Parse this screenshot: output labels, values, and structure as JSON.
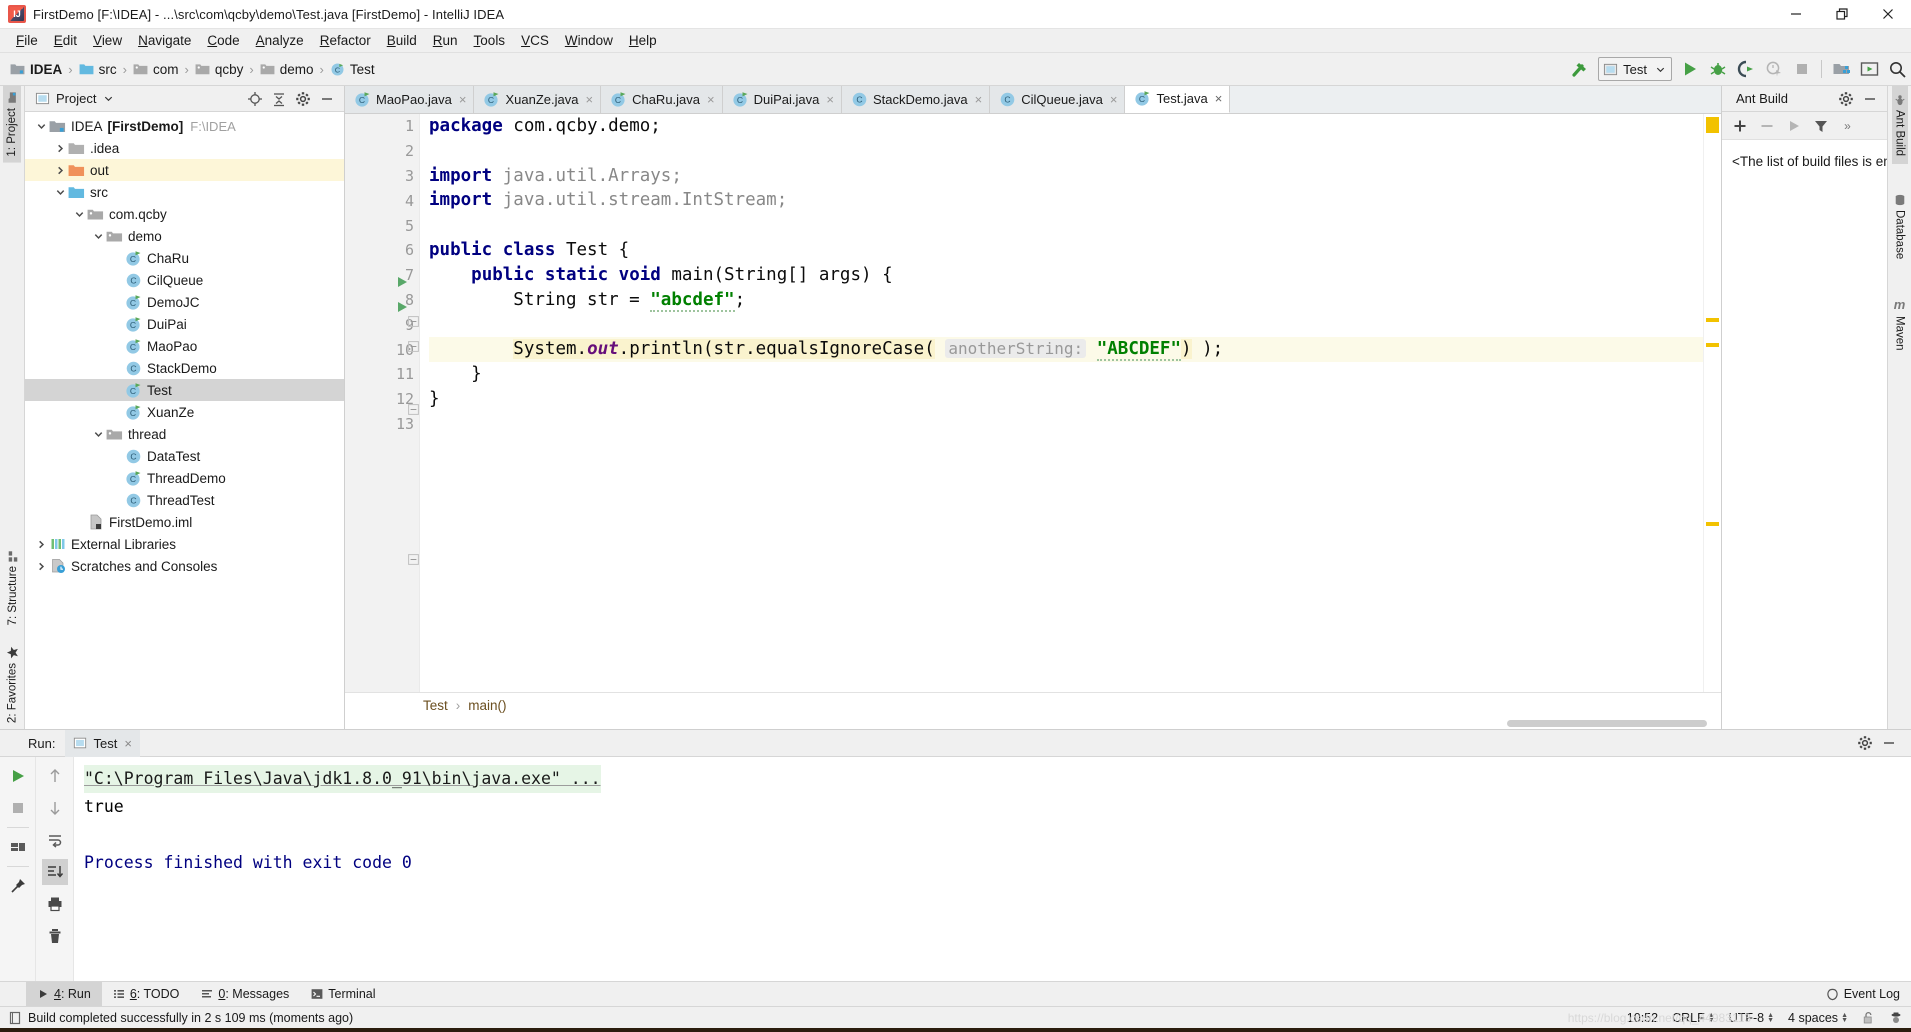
{
  "window": {
    "title": "FirstDemo [F:\\IDEA] - ...\\src\\com\\qcby\\demo\\Test.java [FirstDemo] - IntelliJ IDEA",
    "app_icon": "intellij-idea-icon",
    "minimize": "minimize-icon",
    "maximize": "maximize-icon",
    "close": "close-icon"
  },
  "menubar": [
    {
      "label": "File"
    },
    {
      "label": "Edit"
    },
    {
      "label": "View"
    },
    {
      "label": "Navigate"
    },
    {
      "label": "Code"
    },
    {
      "label": "Analyze"
    },
    {
      "label": "Refactor"
    },
    {
      "label": "Build"
    },
    {
      "label": "Run"
    },
    {
      "label": "Tools"
    },
    {
      "label": "VCS"
    },
    {
      "label": "Window"
    },
    {
      "label": "Help"
    }
  ],
  "navbar": {
    "crumbs": [
      {
        "label": "IDEA",
        "icon": "module-icon",
        "bold": true
      },
      {
        "label": "src",
        "icon": "source-folder-icon",
        "bold": false
      },
      {
        "label": "com",
        "icon": "package-icon",
        "bold": false
      },
      {
        "label": "qcby",
        "icon": "package-icon",
        "bold": false
      },
      {
        "label": "demo",
        "icon": "package-icon",
        "bold": false
      },
      {
        "label": "Test",
        "icon": "java-class-icon",
        "bold": false
      }
    ],
    "separator": "›",
    "build_icon": "hammer-build-icon",
    "run_config": "Test",
    "run_config_icon": "run-configuration-icon",
    "dropdown_icon": "chevron-down-icon",
    "buttons": [
      {
        "name": "run-button",
        "icon": "play-icon"
      },
      {
        "name": "debug-button",
        "icon": "bug-icon"
      },
      {
        "name": "run-with-coverage-button",
        "icon": "coverage-icon"
      },
      {
        "name": "profile-button",
        "icon": "profiler-icon"
      },
      {
        "name": "stop-button",
        "icon": "stop-icon"
      },
      {
        "name": "update-project-button",
        "icon": "update-folder-icon"
      },
      {
        "name": "settings-button",
        "icon": "present-mode-icon"
      },
      {
        "name": "search-everywhere-button",
        "icon": "search-icon"
      }
    ]
  },
  "left_stripe": {
    "top": [
      {
        "label": "1: Project",
        "icon": "project-icon",
        "active": true
      }
    ],
    "bottom": [
      {
        "label": "7: Structure",
        "icon": "structure-icon",
        "active": false
      },
      {
        "label": "2: Favorites",
        "icon": "star-icon",
        "active": false
      }
    ]
  },
  "project_panel": {
    "title": "Project",
    "title_icon": "project-view-icon",
    "dropdown_icon": "chevron-down-icon",
    "actions": [
      {
        "name": "locate-file-button",
        "icon": "crosshair-icon"
      },
      {
        "name": "collapse-all-button",
        "icon": "collapse-all-icon"
      },
      {
        "name": "panel-settings-button",
        "icon": "gear-icon"
      },
      {
        "name": "hide-panel-button",
        "icon": "minimize-icon"
      }
    ],
    "tree": [
      {
        "label": "IDEA",
        "suffix": "[FirstDemo]",
        "path": "F:\\IDEA",
        "indent": 0,
        "twisty": "expanded",
        "icon": "module-icon",
        "state": "normal"
      },
      {
        "label": ".idea",
        "indent": 1,
        "twisty": "collapsed",
        "icon": "folder-icon",
        "state": "normal"
      },
      {
        "label": "out",
        "indent": 1,
        "twisty": "collapsed",
        "icon": "excluded-folder-icon",
        "state": "highlight"
      },
      {
        "label": "src",
        "indent": 1,
        "twisty": "expanded",
        "icon": "source-folder-icon",
        "state": "normal"
      },
      {
        "label": "com.qcby",
        "indent": 2,
        "twisty": "expanded",
        "icon": "package-icon",
        "state": "normal"
      },
      {
        "label": "demo",
        "indent": 3,
        "twisty": "expanded",
        "icon": "package-icon",
        "state": "normal"
      },
      {
        "label": "ChaRu",
        "indent": 4,
        "twisty": "none",
        "icon": "java-class-runnable-icon",
        "state": "normal"
      },
      {
        "label": "CilQueue",
        "indent": 4,
        "twisty": "none",
        "icon": "java-class-icon",
        "state": "normal"
      },
      {
        "label": "DemoJC",
        "indent": 4,
        "twisty": "none",
        "icon": "java-class-runnable-icon",
        "state": "normal"
      },
      {
        "label": "DuiPai",
        "indent": 4,
        "twisty": "none",
        "icon": "java-class-runnable-icon",
        "state": "normal"
      },
      {
        "label": "MaoPao",
        "indent": 4,
        "twisty": "none",
        "icon": "java-class-runnable-icon",
        "state": "normal"
      },
      {
        "label": "StackDemo",
        "indent": 4,
        "twisty": "none",
        "icon": "java-class-icon",
        "state": "normal"
      },
      {
        "label": "Test",
        "indent": 4,
        "twisty": "none",
        "icon": "java-class-runnable-icon",
        "state": "selected"
      },
      {
        "label": "XuanZe",
        "indent": 4,
        "twisty": "none",
        "icon": "java-class-runnable-icon",
        "state": "normal"
      },
      {
        "label": "thread",
        "indent": 3,
        "twisty": "expanded",
        "icon": "package-icon",
        "state": "normal"
      },
      {
        "label": "DataTest",
        "indent": 4,
        "twisty": "none",
        "icon": "java-class-icon",
        "state": "normal"
      },
      {
        "label": "ThreadDemo",
        "indent": 4,
        "twisty": "none",
        "icon": "java-class-runnable-icon",
        "state": "normal"
      },
      {
        "label": "ThreadTest",
        "indent": 4,
        "twisty": "none",
        "icon": "java-class-icon",
        "state": "normal"
      },
      {
        "label": "FirstDemo.iml",
        "indent": 2,
        "twisty": "none",
        "icon": "iml-file-icon",
        "state": "normal"
      },
      {
        "label": "External Libraries",
        "indent": 0,
        "twisty": "collapsed",
        "icon": "libraries-icon",
        "state": "normal"
      },
      {
        "label": "Scratches and Consoles",
        "indent": 0,
        "twisty": "collapsed",
        "icon": "scratches-icon",
        "state": "normal"
      }
    ]
  },
  "editor": {
    "tabs": [
      {
        "label": "MaoPao.java",
        "icon": "java-class-runnable-icon",
        "active": false,
        "close": "×"
      },
      {
        "label": "XuanZe.java",
        "icon": "java-class-runnable-icon",
        "active": false,
        "close": "×"
      },
      {
        "label": "ChaRu.java",
        "icon": "java-class-runnable-icon",
        "active": false,
        "close": "×"
      },
      {
        "label": "DuiPai.java",
        "icon": "java-class-runnable-icon",
        "active": false,
        "close": "×"
      },
      {
        "label": "StackDemo.java",
        "icon": "java-class-icon",
        "active": false,
        "close": "×"
      },
      {
        "label": "CilQueue.java",
        "icon": "java-class-icon",
        "active": false,
        "close": "×"
      },
      {
        "label": "Test.java",
        "icon": "java-class-runnable-icon",
        "active": true,
        "close": "×"
      }
    ],
    "line_numbers": [
      "1",
      "2",
      "3",
      "4",
      "5",
      "6",
      "7",
      "8",
      "9",
      "10",
      "11",
      "12",
      "13"
    ],
    "code_lines": [
      "package com.qcby.demo;",
      "",
      "import java.util.Arrays;",
      "import java.util.stream.IntStream;",
      "",
      "public class Test {",
      "    public static void main(String[] args) {",
      "        String str = \"abcdef\";",
      "",
      "        System.out.println(str.equalsIgnoreCase( anotherString: \"ABCDEF\") );",
      "    }",
      "}",
      ""
    ],
    "inlay_hint": "anotherString:",
    "breadcrumb": {
      "class": "Test",
      "method": "main()",
      "separator": "›"
    }
  },
  "right_panel": {
    "title": "Ant Build",
    "actions": [
      {
        "name": "ant-settings-button",
        "icon": "gear-icon"
      },
      {
        "name": "ant-hide-button",
        "icon": "minimize-icon"
      }
    ],
    "toolbar": [
      {
        "name": "add-build-file-button",
        "icon": "plus-icon"
      },
      {
        "name": "remove-build-file-button",
        "icon": "minus-icon"
      },
      {
        "name": "run-ant-target-button",
        "icon": "play-icon"
      },
      {
        "name": "filter-targets-button",
        "icon": "filter-icon"
      },
      {
        "name": "more-actions-button",
        "icon": "chevron-double-right-icon"
      }
    ],
    "empty_text": "<The list of build files is empty>"
  },
  "right_stripe": [
    {
      "label": "Ant Build",
      "icon": "ant-icon",
      "active": true
    },
    {
      "label": "Database",
      "icon": "database-icon",
      "active": false
    },
    {
      "label": "Maven",
      "icon": "maven-icon",
      "active": false
    }
  ],
  "run_panel": {
    "label": "Run:",
    "tab": "Test",
    "tab_icon": "run-configuration-icon",
    "tab_close": "×",
    "actions": [
      {
        "name": "run-settings-button",
        "icon": "gear-icon"
      },
      {
        "name": "run-hide-button",
        "icon": "minimize-icon"
      }
    ],
    "left_tools": [
      {
        "name": "rerun-button",
        "icon": "play-icon"
      },
      {
        "name": "stop-process-button",
        "icon": "stop-icon"
      },
      {
        "name": "restore-layout-button",
        "icon": "layout-icon"
      },
      {
        "name": "pin-tab-button",
        "icon": "pin-icon"
      }
    ],
    "right_tools": [
      {
        "name": "up-stacktrace-button",
        "icon": "arrow-up-icon"
      },
      {
        "name": "down-stacktrace-button",
        "icon": "arrow-down-icon"
      },
      {
        "name": "soft-wrap-button",
        "icon": "wrap-icon"
      },
      {
        "name": "scroll-to-end-button",
        "icon": "scroll-end-icon"
      },
      {
        "name": "print-button",
        "icon": "printer-icon"
      },
      {
        "name": "clear-all-button",
        "icon": "trash-icon"
      }
    ],
    "console_lines": [
      {
        "text": "\"C:\\Program Files\\Java\\jdk1.8.0_91\\bin\\java.exe\" ...",
        "style": "command"
      },
      {
        "text": "true",
        "style": "output"
      },
      {
        "text": "",
        "style": "output"
      },
      {
        "text": "Process finished with exit code 0",
        "style": "system"
      }
    ]
  },
  "bottom_tools": [
    {
      "label": "4: Run",
      "num": "4",
      "rest": ": Run",
      "icon": "play-icon",
      "active": true
    },
    {
      "label": "6: TODO",
      "num": "6",
      "rest": ": TODO",
      "icon": "todo-icon",
      "active": false
    },
    {
      "label": "0: Messages",
      "num": "0",
      "rest": ": Messages",
      "icon": "messages-icon",
      "active": false
    },
    {
      "label": "Terminal",
      "num": "",
      "rest": "Terminal",
      "icon": "terminal-icon",
      "active": false
    }
  ],
  "event_log": {
    "label": "Event Log",
    "icon": "event-log-icon"
  },
  "statusbar": {
    "message": "Build completed successfully in 2 s 109 ms (moments ago)",
    "message_icon": "build-status-icon",
    "position": "10:52",
    "line_separator": "CRLF",
    "encoding": "UTF-8",
    "indent": "4 spaces",
    "lock_icon": "unlocked-icon",
    "inspection_icon": "inspection-hector-icon"
  },
  "colors": {
    "accent_green": "#45a045",
    "keyword_blue": "#000080",
    "string_green": "#008000",
    "field_purple": "#660e7a",
    "marker_yellow": "#f2c200",
    "selection_gray": "#d4d4d4",
    "highlight_line": "#fcfae8"
  }
}
